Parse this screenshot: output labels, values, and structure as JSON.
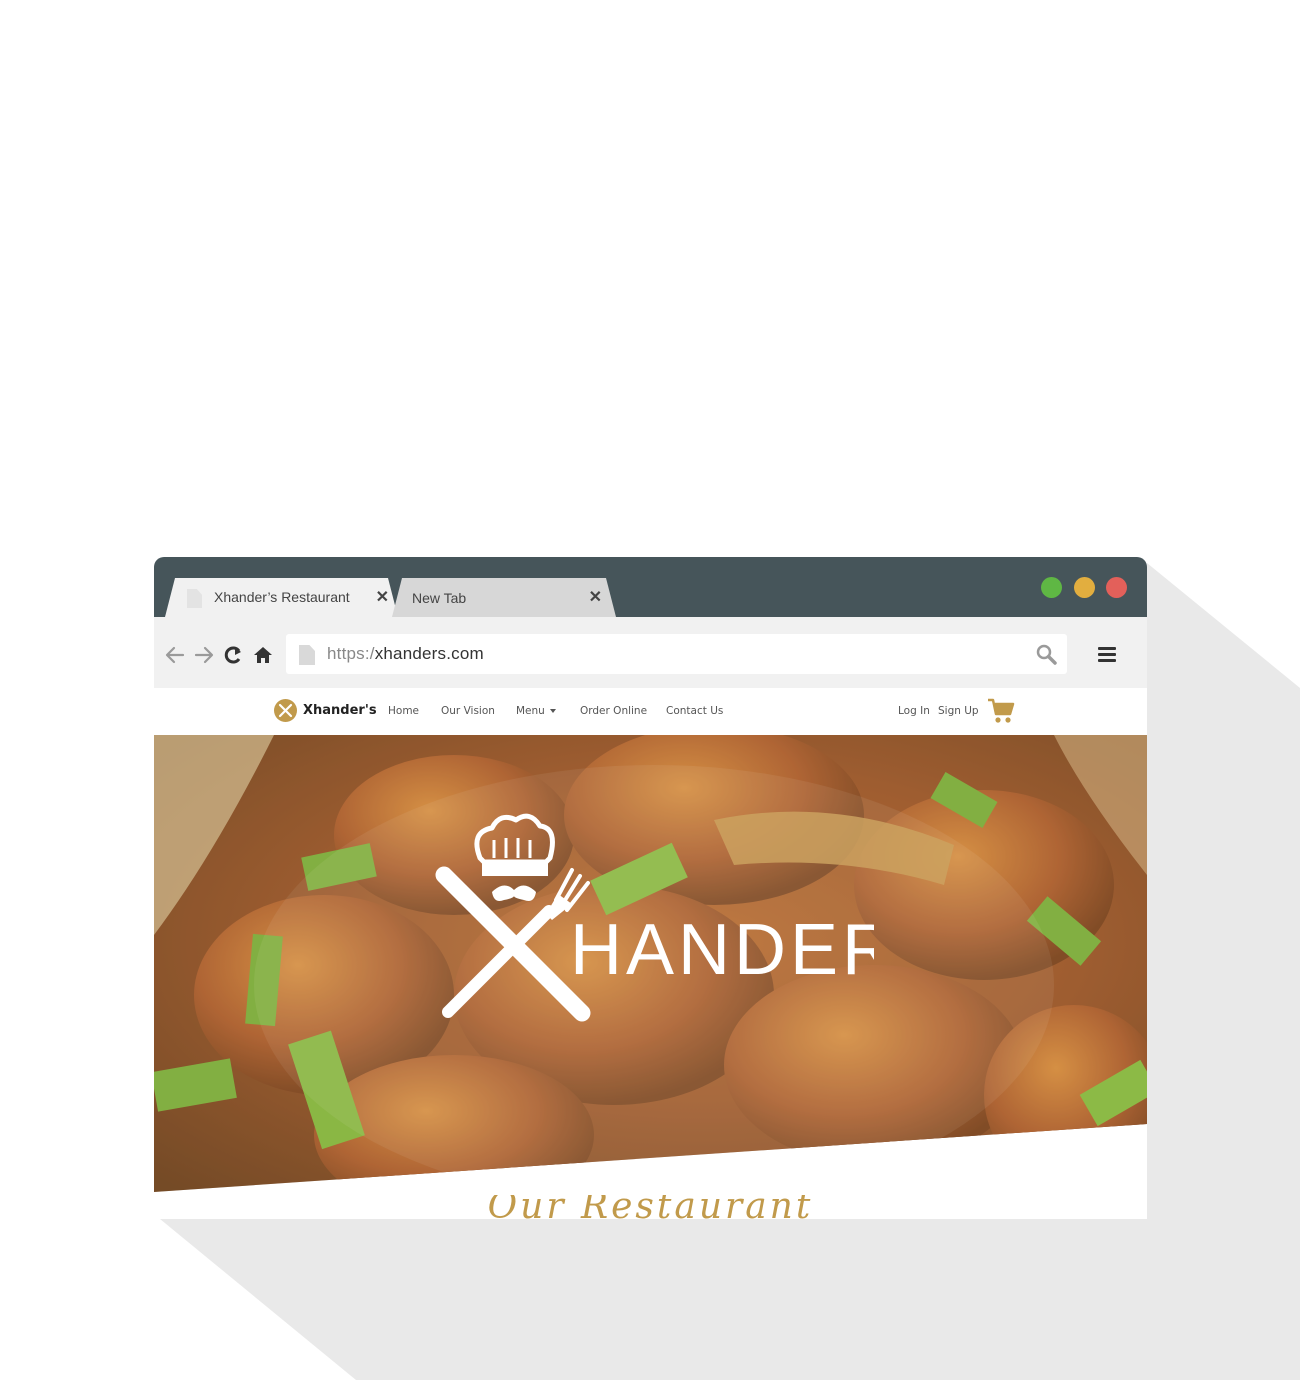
{
  "window": {
    "traffic_lights": [
      "#5fb744",
      "#e2ae3f",
      "#e3605a"
    ],
    "titlebar_color": "#46555a"
  },
  "tabs": [
    {
      "title": "Xhander’s Restaurant",
      "close": "✕",
      "active": true
    },
    {
      "title": "New Tab",
      "close": "✕",
      "active": false
    }
  ],
  "toolbar": {
    "url_scheme": "https:/",
    "url_host": "xhanders.com",
    "icons": [
      "back-arrow-icon",
      "forward-arrow-icon",
      "reload-icon",
      "home-icon",
      "search-icon",
      "hamburger-menu-icon"
    ]
  },
  "site": {
    "brand": "Xhander's",
    "nav": [
      "Home",
      "Our Vision",
      "Menu",
      "Order Online",
      "Contact Us"
    ],
    "auth": [
      "Log In",
      "Sign Up"
    ],
    "accent": "#c19a4b",
    "hero_logo_text": "HANDER’S",
    "section_title": "Our Restaurant"
  }
}
